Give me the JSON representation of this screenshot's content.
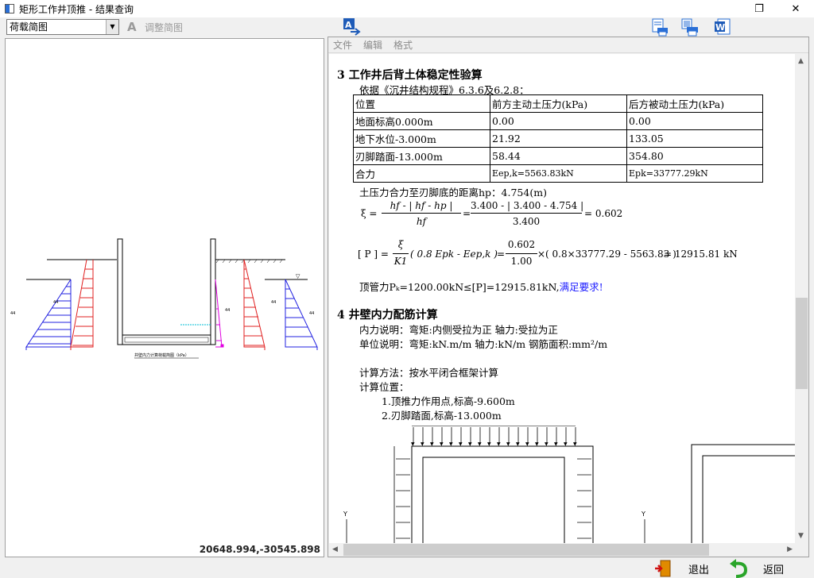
{
  "window": {
    "title": "矩形工作井顶推 - 结果查询"
  },
  "toolbar": {
    "view_select": "荷载简图",
    "adjust_label": "调整简图"
  },
  "left": {
    "coords": "20648.994,-30545.898",
    "diagram_caption": "井壁内力计算荷载简图（kPa）"
  },
  "menu": [
    "文件",
    "编辑",
    "格式"
  ],
  "doc": {
    "sec3_title": "3  工作井后背土体稳定性验算",
    "basis": "依据《沉井结构规程》6.3.6及6.2.8：",
    "table": {
      "headers": [
        "位置",
        "前方主动土压力(kPa)",
        "后方被动土压力(kPa)"
      ],
      "rows": [
        [
          "地面标高0.000m",
          "0.00",
          "0.00"
        ],
        [
          "地下水位-3.000m",
          "21.92",
          "133.05"
        ],
        [
          "刃脚踏面-13.000m",
          "58.44",
          "354.80"
        ],
        [
          "合力",
          "Eep,k=5563.83kN",
          "Epk=33777.29kN"
        ]
      ]
    },
    "hp_line": "土压力合力至刃脚底的距离hp：4.754(m)",
    "xi_formula": {
      "lhs": "ξ =",
      "num1": "hf - | hf - hp |",
      "den1": "hf",
      "num2": "3.400 - | 3.400 - 4.754 |",
      "den2": "3.400",
      "result": "= 0.602"
    },
    "p_formula": {
      "lhs": "[ P ] =",
      "frac_num": "ξ",
      "frac_den": "K1",
      "expr": "( 0.8 Epk - Eep,k )",
      "num2": "0.602",
      "den2": "1.00",
      "expr2": "×( 0.8×33777.29 - 5563.83 )",
      "result": "= 12915.81 kN"
    },
    "conclusion_prefix": "顶管力Pₖ=1200.00kN≤[P]=12915.81kN,",
    "conclusion_ok": "满足要求!",
    "sec4_title": "4  井壁内力配筋计算",
    "lines": [
      "内力说明：弯矩:内侧受拉为正   轴力:受拉为正",
      "单位说明：弯矩:kN.m/m   轴力:kN/m   钢筋面积:mm²/m",
      "计算方法：按水平闭合框架计算",
      "计算位置：",
      "1.顶推力作用点,标高-9.600m",
      "2.刃脚踏面,标高-13.000m"
    ],
    "axis_label": "Y"
  },
  "bottom": {
    "exit_label": "退出",
    "back_label": "返回"
  },
  "colors": {
    "active_pressure": "#e02020",
    "passive_pressure": "#2020e0",
    "water": "#e000e0",
    "ok_text": "#1a1aff"
  },
  "icons": [
    "word-doc-icon",
    "print-icon",
    "print-preview-icon",
    "font-edit-icon",
    "exit-door-icon",
    "back-arrow-icon"
  ]
}
